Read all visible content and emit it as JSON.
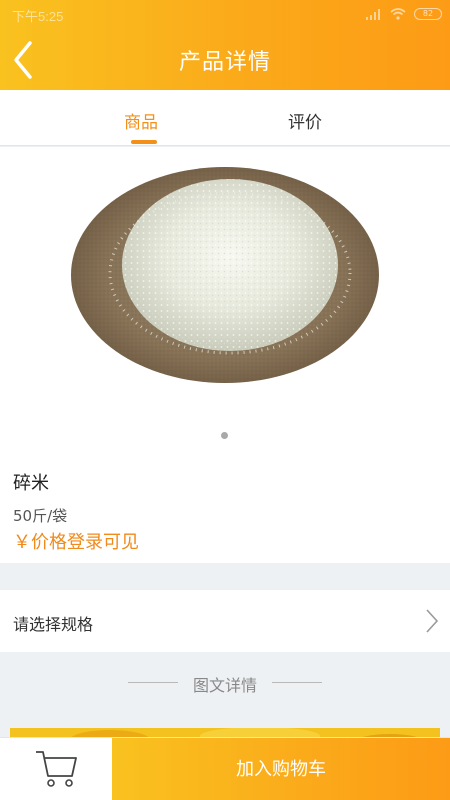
{
  "status_bar": {
    "time": "下午5:25",
    "battery": "82"
  },
  "header": {
    "title": "产品详情",
    "back_icon": "chevron-left-icon"
  },
  "tabs": [
    {
      "label": "商品",
      "active": true
    },
    {
      "label": "评价",
      "active": false
    }
  ],
  "gallery": {
    "current_index": 1,
    "count": 1
  },
  "product": {
    "name": "碎米",
    "spec": "50斤/袋",
    "price": "￥价格登录可见"
  },
  "spec_select": {
    "label": "请选择规格"
  },
  "detail_section": {
    "label": "图文详情"
  },
  "bottom_bar": {
    "add_to_cart": "加入购物车",
    "cart_icon": "cart-icon"
  },
  "colors": {
    "accent": "#f39019",
    "header_start": "#f9c21f",
    "header_end": "#fd9b16",
    "price": "#f08a1b"
  }
}
